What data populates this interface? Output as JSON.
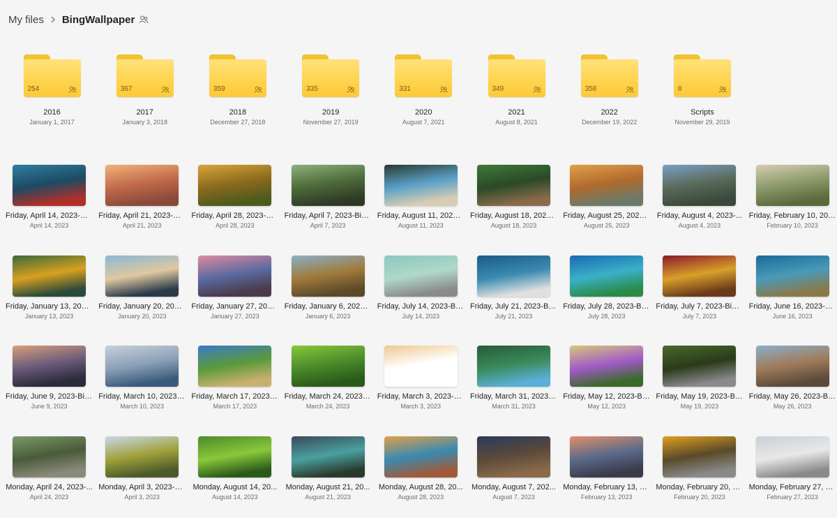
{
  "breadcrumb": {
    "root": "My files",
    "current": "BingWallpaper"
  },
  "folders": [
    {
      "name": "2016",
      "date": "January 1, 2017",
      "count": "254"
    },
    {
      "name": "2017",
      "date": "January 3, 2018",
      "count": "367"
    },
    {
      "name": "2018",
      "date": "December 27, 2018",
      "count": "359"
    },
    {
      "name": "2019",
      "date": "November 27, 2019",
      "count": "335"
    },
    {
      "name": "2020",
      "date": "August 7, 2021",
      "count": "331"
    },
    {
      "name": "2021",
      "date": "August 8, 2021",
      "count": "349"
    },
    {
      "name": "2022",
      "date": "December 19, 2022",
      "count": "358"
    },
    {
      "name": "Scripts",
      "date": "November 29, 2019",
      "count": "8"
    }
  ],
  "photos": [
    [
      {
        "name": "Friday, April 14, 2023-Bi...",
        "date": "April 14, 2023",
        "colors": [
          "#2f7fa0",
          "#1d4a63",
          "#b03028"
        ]
      },
      {
        "name": "Friday, April 21, 2023-Bi...",
        "date": "April 21, 2023",
        "colors": [
          "#f0b37a",
          "#c26a4a",
          "#8a4a3a"
        ]
      },
      {
        "name": "Friday, April 28, 2023-Bi...",
        "date": "April 28, 2023",
        "colors": [
          "#d9a63a",
          "#8a6a1e",
          "#4e5a1c"
        ]
      },
      {
        "name": "Friday, April 7, 2023-Bin...",
        "date": "April 7, 2023",
        "colors": [
          "#8fb07a",
          "#4d6a3a",
          "#2f3a26"
        ]
      },
      {
        "name": "Friday, August 11, 2023-...",
        "date": "August 11, 2023",
        "colors": [
          "#2a3a2e",
          "#5aa0c8",
          "#d8cdb3"
        ]
      },
      {
        "name": "Friday, August 18, 2023-...",
        "date": "August 18, 2023",
        "colors": [
          "#3f7a3a",
          "#2a4a26",
          "#8a6a4a"
        ]
      },
      {
        "name": "Friday, August 25, 2023-...",
        "date": "August 25, 2023",
        "colors": [
          "#e0a04a",
          "#b06a2e",
          "#6a7a6a"
        ]
      },
      {
        "name": "Friday, August 4, 2023-...",
        "date": "August 4, 2023",
        "colors": [
          "#7aa0c8",
          "#5a6a5a",
          "#3a4a3a"
        ]
      },
      {
        "name": "Friday, February 10, 202...",
        "date": "February 10, 2023",
        "colors": [
          "#d8cdb3",
          "#8a9a6a",
          "#5a6a3a"
        ]
      }
    ],
    [
      {
        "name": "Friday, January 13, 2023...",
        "date": "January 13, 2023",
        "colors": [
          "#3a6a3a",
          "#d8a020",
          "#2a4a3a"
        ]
      },
      {
        "name": "Friday, January 20, 2023...",
        "date": "January 20, 2023",
        "colors": [
          "#8ab8d8",
          "#e0c8a0",
          "#2a3a4a"
        ]
      },
      {
        "name": "Friday, January 27, 2023...",
        "date": "January 27, 2023",
        "colors": [
          "#e08aa0",
          "#5a6aa0",
          "#4a3a4a"
        ]
      },
      {
        "name": "Friday, January 6, 2023-...",
        "date": "January 6, 2023",
        "colors": [
          "#8ab0c8",
          "#a07a3a",
          "#5a4a2a"
        ]
      },
      {
        "name": "Friday, July 14, 2023-Bin...",
        "date": "July 14, 2023",
        "colors": [
          "#8ac8c0",
          "#b0d8c8",
          "#8a8a8a"
        ]
      },
      {
        "name": "Friday, July 21, 2023-Bin...",
        "date": "July 21, 2023",
        "colors": [
          "#1a5a8a",
          "#3a8ab0",
          "#e0e0e0"
        ]
      },
      {
        "name": "Friday, July 28, 2023-Bin...",
        "date": "July 28, 2023",
        "colors": [
          "#1a6ab0",
          "#3ab0c8",
          "#2a8a4a"
        ]
      },
      {
        "name": "Friday, July 7, 2023-Bing...",
        "date": "July 7, 2023",
        "colors": [
          "#8a1a2a",
          "#d8a02a",
          "#6a3a1a"
        ]
      },
      {
        "name": "Friday, June 16, 2023-Bi...",
        "date": "June 16, 2023",
        "colors": [
          "#1a6a9a",
          "#4a9ab8",
          "#8a7a4a"
        ]
      }
    ],
    [
      {
        "name": "Friday, June 9, 2023-Bin...",
        "date": "June 9, 2023",
        "colors": [
          "#d8a07a",
          "#6a5a7a",
          "#2a2a3a"
        ]
      },
      {
        "name": "Friday, March 10, 2023-...",
        "date": "March 10, 2023",
        "colors": [
          "#c8d0d8",
          "#8aa0b8",
          "#3a5a7a"
        ]
      },
      {
        "name": "Friday, March 17, 2023-...",
        "date": "March 17, 2023",
        "colors": [
          "#3a7ac8",
          "#5a9a3a",
          "#c8b070"
        ]
      },
      {
        "name": "Friday, March 24, 2023-...",
        "date": "March 24, 2023",
        "colors": [
          "#8ac83a",
          "#4a8a2a",
          "#2a5a1a"
        ]
      },
      {
        "name": "Friday, March 3, 2023-Bi...",
        "date": "March 3, 2023",
        "colors": [
          "#f0c890",
          "#ffffff",
          "#ffffff"
        ]
      },
      {
        "name": "Friday, March 31, 2023-...",
        "date": "March 31, 2023",
        "colors": [
          "#2a5a3a",
          "#3a8a5a",
          "#5ab0d8"
        ]
      },
      {
        "name": "Friday, May 12, 2023-Bi...",
        "date": "May 12, 2023",
        "colors": [
          "#d8c87a",
          "#a05ac8",
          "#3a6a2a"
        ]
      },
      {
        "name": "Friday, May 19, 2023-Bi...",
        "date": "May 19, 2023",
        "colors": [
          "#4a6a2a",
          "#2a3a1a",
          "#8a8a8a"
        ]
      },
      {
        "name": "Friday, May 26, 2023-Bi...",
        "date": "May 26, 2023",
        "colors": [
          "#8ab0c8",
          "#a07a5a",
          "#5a4a3a"
        ]
      }
    ],
    [
      {
        "name": "Monday, April 24, 2023-...",
        "date": "April 24, 2023",
        "colors": [
          "#7a9a6a",
          "#4a5a3a",
          "#8a8a7a"
        ]
      },
      {
        "name": "Monday, April 3, 2023-B...",
        "date": "April 3, 2023",
        "colors": [
          "#c8d8e8",
          "#a0a03a",
          "#4a5a2a"
        ]
      },
      {
        "name": "Monday, August 14, 20...",
        "date": "August 14, 2023",
        "colors": [
          "#4a8a2a",
          "#8ac83a",
          "#2a5a1a"
        ]
      },
      {
        "name": "Monday, August 21, 20...",
        "date": "August 21, 2023",
        "colors": [
          "#3a4a5a",
          "#4aa0a0",
          "#2a3a2a"
        ]
      },
      {
        "name": "Monday, August 28, 20...",
        "date": "August 28, 2023",
        "colors": [
          "#e0a04a",
          "#3a8ab0",
          "#a05a3a"
        ]
      },
      {
        "name": "Monday, August 7, 202...",
        "date": "August 7, 2023",
        "colors": [
          "#2a3a5a",
          "#5a4a3a",
          "#8a6a4a"
        ]
      },
      {
        "name": "Monday, February 13, 2...",
        "date": "February 13, 2023",
        "colors": [
          "#e0906a",
          "#5a6a8a",
          "#3a3a4a"
        ]
      },
      {
        "name": "Monday, February 20, 2...",
        "date": "February 20, 2023",
        "colors": [
          "#e0a020",
          "#5a4a2a",
          "#8a8a8a"
        ]
      },
      {
        "name": "Monday, February 27, 2...",
        "date": "February 27, 2023",
        "colors": [
          "#c8d0d8",
          "#e8e8e8",
          "#8a8a8a"
        ]
      }
    ]
  ]
}
